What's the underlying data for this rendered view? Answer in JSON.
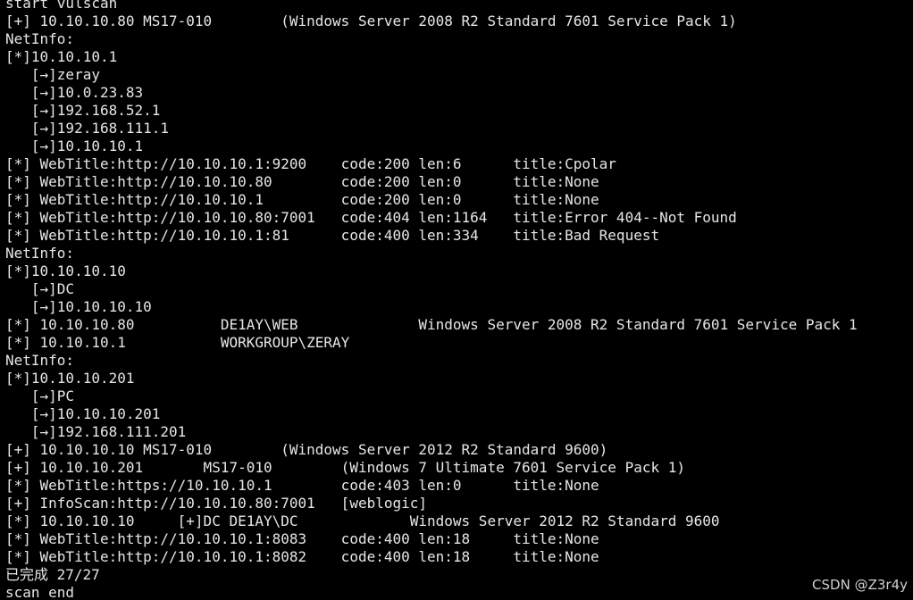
{
  "terminal": {
    "lines": [
      "start vulscan",
      "[+] 10.10.10.80 MS17-010        (Windows Server 2008 R2 Standard 7601 Service Pack 1)",
      "NetInfo:",
      "[*]10.10.10.1",
      "   [→]zeray",
      "   [→]10.0.23.83",
      "   [→]192.168.52.1",
      "   [→]192.168.111.1",
      "   [→]10.10.10.1",
      "[*] WebTitle:http://10.10.10.1:9200    code:200 len:6      title:Cpolar",
      "[*] WebTitle:http://10.10.10.80        code:200 len:0      title:None",
      "[*] WebTitle:http://10.10.10.1         code:200 len:0      title:None",
      "[*] WebTitle:http://10.10.10.80:7001   code:404 len:1164   title:Error 404--Not Found",
      "[*] WebTitle:http://10.10.10.1:81      code:400 len:334    title:Bad Request",
      "NetInfo:",
      "[*]10.10.10.10",
      "   [→]DC",
      "   [→]10.10.10.10",
      "[*] 10.10.10.80          DE1AY\\WEB              Windows Server 2008 R2 Standard 7601 Service Pack 1",
      "[*] 10.10.10.1           WORKGROUP\\ZERAY",
      "NetInfo:",
      "[*]10.10.10.201",
      "   [→]PC",
      "   [→]10.10.10.201",
      "   [→]192.168.111.201",
      "[+] 10.10.10.10 MS17-010        (Windows Server 2012 R2 Standard 9600)",
      "[+] 10.10.10.201       MS17-010        (Windows 7 Ultimate 7601 Service Pack 1)",
      "[*] WebTitle:https://10.10.10.1        code:403 len:0      title:None",
      "[+] InfoScan:http://10.10.10.80:7001   [weblogic]",
      "[*] 10.10.10.10     [+]DC DE1AY\\DC             Windows Server 2012 R2 Standard 9600",
      "[*] WebTitle:http://10.10.10.1:8083    code:400 len:18     title:None",
      "[*] WebTitle:http://10.10.10.1:8082    code:400 len:18     title:None",
      "已完成 27/27",
      "scan end"
    ]
  },
  "watermark": "CSDN @Z3r4y",
  "colors": {
    "background": "#000000",
    "text": "#e6e6e6"
  }
}
